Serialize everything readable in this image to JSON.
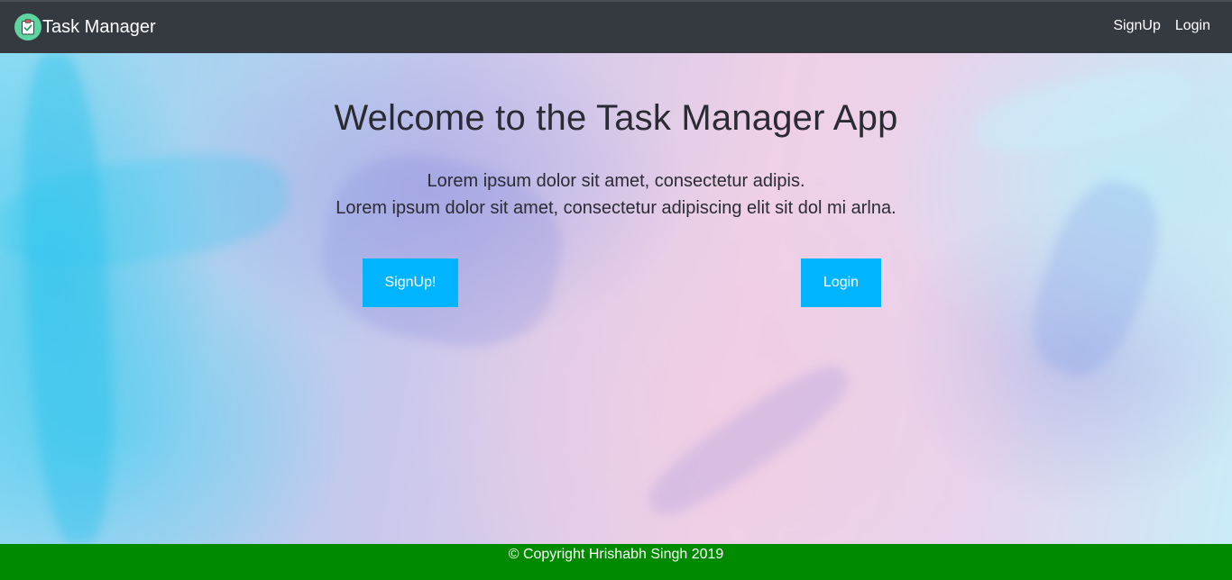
{
  "navbar": {
    "logo_icon": "clipboard-check-icon",
    "brand_title": "Task Manager",
    "links": [
      "SignUp",
      "Login"
    ]
  },
  "hero": {
    "title": "Welcome to the Task Manager App",
    "lines": [
      "Lorem ipsum dolor sit amet, consectetur adipis.",
      "Lorem ipsum dolor sit amet, consectetur adipiscing elit sit dol mi arlna."
    ],
    "signup_button": "SignUp!",
    "login_button": "Login"
  },
  "footer": {
    "copyright": "© Copyright Hrishabh Singh 2019"
  },
  "colors": {
    "navbar_bg": "#343a40",
    "button_bg": "#00b4ff",
    "footer_bg": "#008a00",
    "logo_bg": "#5fd3a0"
  }
}
